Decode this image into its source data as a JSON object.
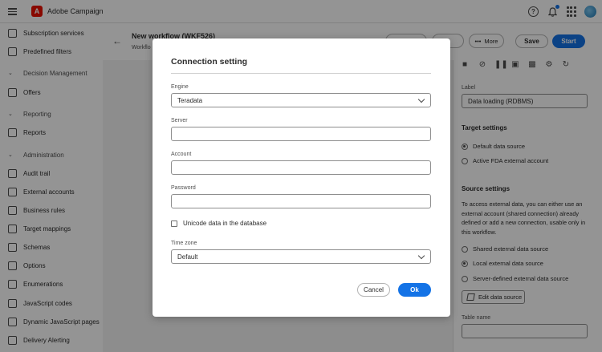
{
  "app": {
    "name": "Adobe Campaign",
    "logo_letter": "A"
  },
  "topbar": {
    "help_glyph": "?"
  },
  "sidebar": {
    "items": [
      {
        "label": "Subscription services",
        "icon": "subscription-icon"
      },
      {
        "label": "Predefined filters",
        "icon": "filter-icon"
      }
    ],
    "sections": [
      {
        "label": "Decision Management",
        "items": [
          {
            "label": "Offers",
            "icon": "offers-icon"
          }
        ]
      },
      {
        "label": "Reporting",
        "items": [
          {
            "label": "Reports",
            "icon": "reports-icon"
          }
        ]
      },
      {
        "label": "Administration",
        "items": [
          {
            "label": "Audit trail",
            "icon": "audit-icon"
          },
          {
            "label": "External accounts",
            "icon": "external-accounts-icon"
          },
          {
            "label": "Business rules",
            "icon": "business-rules-icon"
          },
          {
            "label": "Target mappings",
            "icon": "target-mappings-icon"
          },
          {
            "label": "Schemas",
            "icon": "schemas-icon"
          },
          {
            "label": "Options",
            "icon": "options-icon"
          },
          {
            "label": "Enumerations",
            "icon": "enumerations-icon"
          },
          {
            "label": "JavaScript codes",
            "icon": "javascript-icon"
          },
          {
            "label": "Dynamic JavaScript pages",
            "icon": "dynamic-js-icon"
          },
          {
            "label": "Delivery Alerting",
            "icon": "delivery-alert-icon"
          }
        ]
      }
    ]
  },
  "workflow": {
    "title": "New workflow (WKF526)",
    "subtitle": "Workflo",
    "more_label": "More",
    "save_label": "Save",
    "start_label": "Start"
  },
  "right_panel": {
    "label_caption": "Label",
    "label_value": "Data loading (RDBMS)",
    "target_heading": "Target settings",
    "target_options": [
      {
        "label": "Default data source",
        "selected": true
      },
      {
        "label": "Active FDA external account",
        "selected": false
      }
    ],
    "source_heading": "Source settings",
    "source_description": "To access external data, you can either use an external account (shared connection) already defined or add a new connection, usable only in this workflow.",
    "source_options": [
      {
        "label": "Shared external data source",
        "selected": false
      },
      {
        "label": "Local external data source",
        "selected": true
      },
      {
        "label": "Server-defined external data source",
        "selected": false
      }
    ],
    "edit_button": "Edit data source",
    "table_name_caption": "Table name",
    "table_name_value": ""
  },
  "modal": {
    "title": "Connection setting",
    "engine_label": "Engine",
    "engine_value": "Teradata",
    "server_label": "Server",
    "server_value": "",
    "account_label": "Account",
    "account_value": "",
    "password_label": "Password",
    "password_value": "",
    "unicode_label": "Unicode data in the database",
    "unicode_checked": false,
    "timezone_label": "Time zone",
    "timezone_value": "Default",
    "cancel_label": "Cancel",
    "ok_label": "Ok"
  },
  "colors": {
    "accent": "#1473e6",
    "brand": "#eb1000"
  }
}
